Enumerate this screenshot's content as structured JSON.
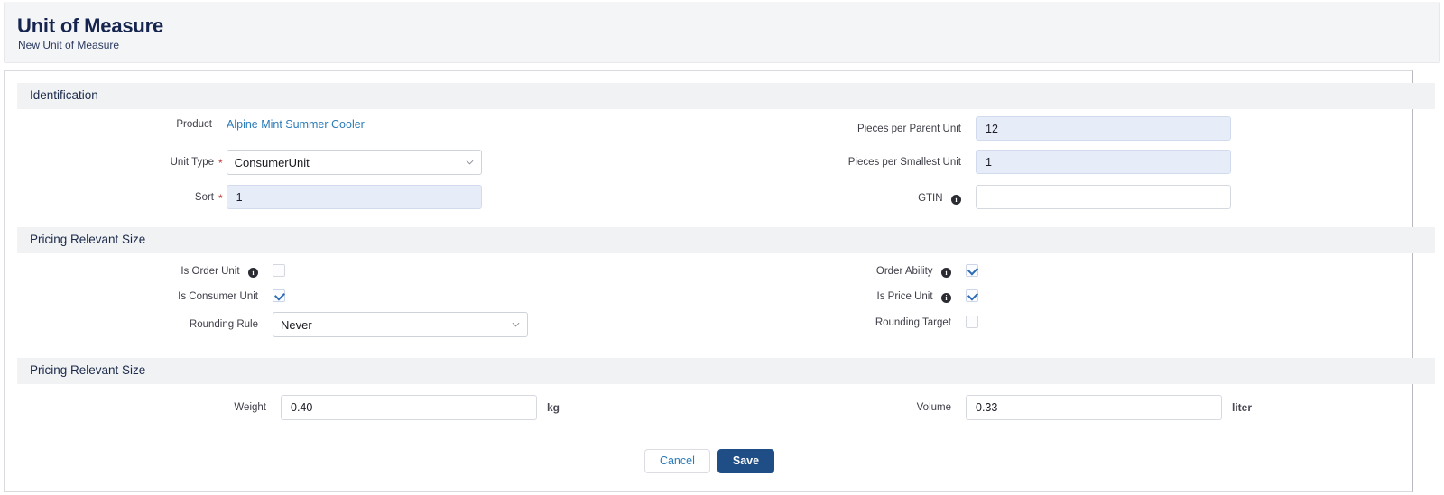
{
  "header": {
    "title": "Unit of Measure",
    "subtitle": "New Unit of Measure"
  },
  "sections": {
    "identification": {
      "title": "Identification",
      "fields": {
        "product": {
          "label": "Product",
          "value": "Alpine Mint Summer Cooler"
        },
        "unit_type": {
          "label": "Unit Type",
          "value": "ConsumerUnit",
          "required": "*",
          "options": [
            "ConsumerUnit"
          ]
        },
        "sort": {
          "label": "Sort",
          "value": "1",
          "required": "*"
        },
        "pieces_per_parent_unit": {
          "label": "Pieces per Parent Unit",
          "value": "12"
        },
        "pieces_per_smallest_unit": {
          "label": "Pieces per Smallest Unit",
          "value": "1"
        },
        "gtin": {
          "label": "GTIN",
          "value": "",
          "info": "i"
        }
      }
    },
    "pricing_relevant_size_1": {
      "title": "Pricing Relevant Size",
      "fields": {
        "is_order_unit": {
          "label": "Is Order Unit",
          "info": "i",
          "checked": false
        },
        "is_consumer_unit": {
          "label": "Is Consumer Unit",
          "checked": true
        },
        "rounding_rule": {
          "label": "Rounding Rule",
          "value": "Never",
          "options": [
            "Never"
          ]
        },
        "order_ability": {
          "label": "Order Ability",
          "info": "i",
          "checked": true
        },
        "is_price_unit": {
          "label": "Is Price Unit",
          "info": "i",
          "checked": true
        },
        "rounding_target": {
          "label": "Rounding Target",
          "checked": false
        }
      }
    },
    "pricing_relevant_size_2": {
      "title": "Pricing Relevant Size",
      "fields": {
        "weight": {
          "label": "Weight",
          "value": "0.40",
          "unit": "kg"
        },
        "volume": {
          "label": "Volume",
          "value": "0.33",
          "unit": "liter"
        }
      }
    }
  },
  "footer": {
    "cancel_label": "Cancel",
    "save_label": "Save"
  },
  "colors": {
    "brand_navy": "#16254f",
    "link_blue": "#2b7bb9",
    "save_blue": "#1f4e86",
    "required_red": "#c23934",
    "filled_input": "#e7ecf9",
    "section_bar": "#f1f2f4"
  }
}
